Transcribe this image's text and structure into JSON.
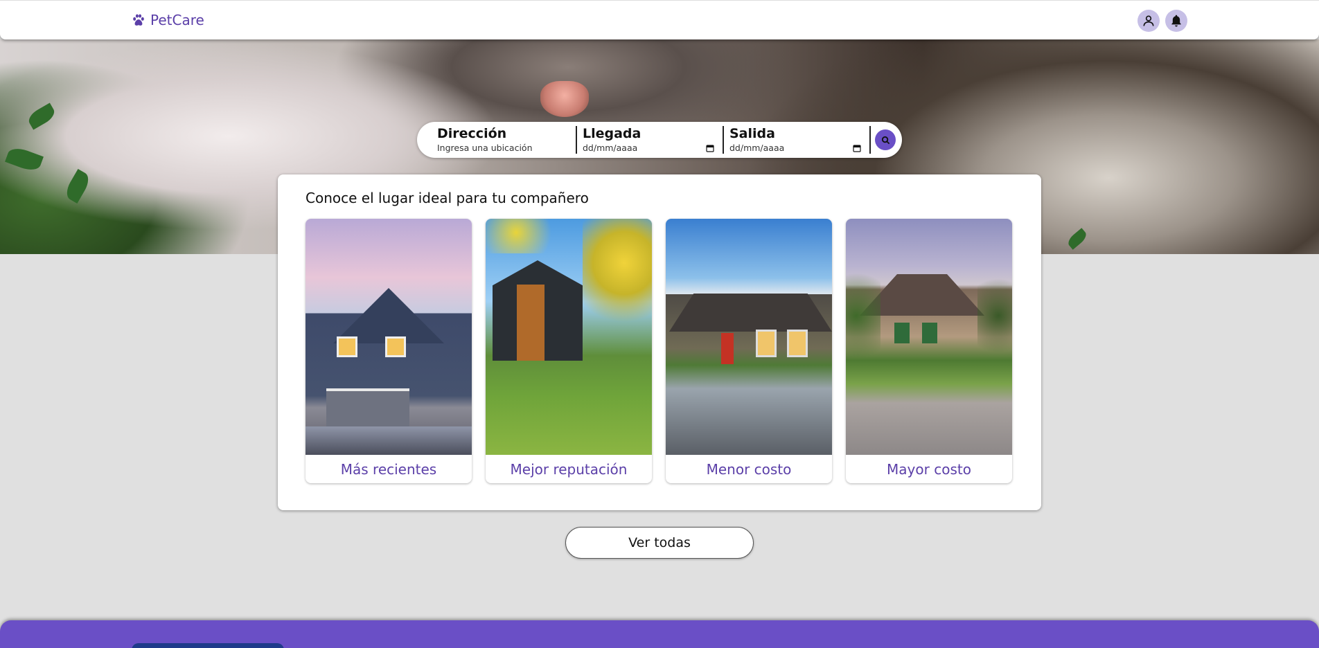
{
  "brand": {
    "name": "PetCare",
    "icon": "paw-icon",
    "color": "#5b3fa8"
  },
  "header": {
    "icons": [
      "user-icon",
      "bell-icon"
    ]
  },
  "search": {
    "address": {
      "label": "Dirección",
      "placeholder": "Ingresa una ubicación"
    },
    "arrival": {
      "label": "Llegada",
      "placeholder": "dd/mm/aaaa"
    },
    "departure": {
      "label": "Salida",
      "placeholder": "dd/mm/aaaa"
    },
    "button_icon": "search-icon"
  },
  "main": {
    "title": "Conoce el lugar ideal para tu compañero",
    "categories": [
      {
        "label": "Más recientes"
      },
      {
        "label": "Mejor reputación"
      },
      {
        "label": "Menor costo"
      },
      {
        "label": "Mayor costo"
      }
    ]
  },
  "see_all": {
    "label": "Ver todas"
  },
  "colors": {
    "accent": "#6a4fc6",
    "background": "#e0e0e0"
  }
}
